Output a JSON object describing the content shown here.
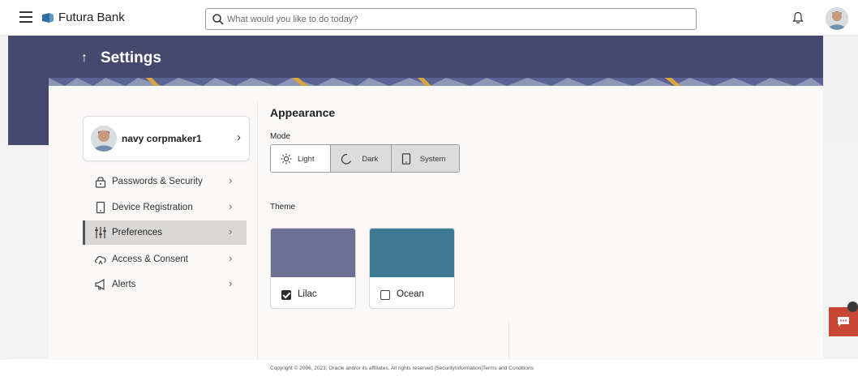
{
  "header": {
    "brand": "Futura Bank",
    "search_placeholder": "What would you like to do today?"
  },
  "page": {
    "title": "Settings",
    "back_arrow": "↑"
  },
  "profile": {
    "name": "navy corpmaker1",
    "chevron": "›"
  },
  "sidebar": {
    "items": [
      {
        "label": "Passwords & Security",
        "icon": "lock-icon",
        "active": false
      },
      {
        "label": "Device Registration",
        "icon": "mobile-device-icon",
        "active": false
      },
      {
        "label": "Preferences",
        "icon": "sliders-icon",
        "active": true
      },
      {
        "label": "Access & Consent",
        "icon": "cloud-access-icon",
        "active": false
      },
      {
        "label": "Alerts",
        "icon": "megaphone-icon",
        "active": false
      }
    ],
    "chevron": "›"
  },
  "appearance": {
    "title": "Appearance",
    "mode_label": "Mode",
    "modes": [
      {
        "label": "Light",
        "icon": "sun-icon",
        "selected": true
      },
      {
        "label": "Dark",
        "icon": "moon-icon",
        "selected": false
      },
      {
        "label": "System",
        "icon": "device-icon",
        "selected": false
      }
    ],
    "theme_label": "Theme",
    "themes": [
      {
        "name": "Lilac",
        "color": "#6b7094",
        "checked": true
      },
      {
        "name": "Ocean",
        "color": "#3f7a95",
        "checked": false
      }
    ]
  },
  "footer": {
    "text": "Copyright © 2006, 2023, Oracle and/or its affiliates. All rights reserved.|SecurityInformation|Terms and Conditions"
  },
  "colors": {
    "banner": "#46496e",
    "chat_button": "#c74634"
  }
}
